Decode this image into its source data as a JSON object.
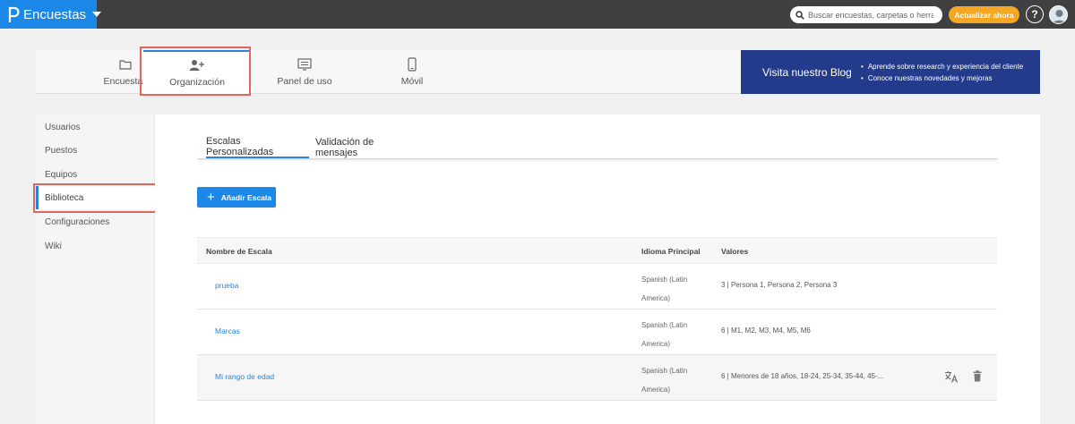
{
  "app": {
    "title": "Encuestas"
  },
  "search": {
    "placeholder": "Buscar encuestas, carpetas o herramientas"
  },
  "topbar": {
    "upgrade_label": "Actualizar ahora",
    "help_label": "?"
  },
  "nav": {
    "tabs": [
      {
        "label": "Encuestas",
        "icon": "folder-icon"
      },
      {
        "label": "Organización",
        "icon": "add-user-icon",
        "active": true
      },
      {
        "label": "Panel de uso",
        "icon": "dashboard-icon"
      },
      {
        "label": "Móvil",
        "icon": "mobile-icon"
      }
    ]
  },
  "blog": {
    "heading": "Visita nuestro Blog",
    "bullets": [
      "Aprende sobre research y experiencia del cliente",
      "Conoce nuestras novedades y mejoras"
    ]
  },
  "sidebar": {
    "items": [
      {
        "label": "Usuarios"
      },
      {
        "label": "Puestos"
      },
      {
        "label": "Equipos"
      },
      {
        "label": "Biblioteca",
        "active": true
      },
      {
        "label": "Configuraciones"
      },
      {
        "label": "Wiki"
      }
    ]
  },
  "subtabs": [
    {
      "label": "Escalas Personalizadas",
      "active": true
    },
    {
      "label": "Validación de mensajes"
    }
  ],
  "add_button": {
    "label": "Añadir Escala"
  },
  "table": {
    "headers": {
      "name": "Nombre de Escala",
      "language": "Idioma Principal",
      "values": "Valores"
    },
    "rows": [
      {
        "name": "prueba",
        "language": "Spanish (Latin America)",
        "values": "3 | Persona 1, Persona 2, Persona 3"
      },
      {
        "name": "Marcas",
        "language": "Spanish (Latin America)",
        "values": "6 | M1, M2, M3, M4, M5, M6"
      },
      {
        "name": "Mi rango de edad",
        "language": "Spanish (Latin America)",
        "values": "6 | Menores de 18 años, 18-24, 25-34, 35-44, 45-..."
      }
    ]
  },
  "colors": {
    "brand": "#1b87e6",
    "accent": "#f5a623",
    "highlight": "#e3665e",
    "blog_bg": "#243b8b"
  }
}
